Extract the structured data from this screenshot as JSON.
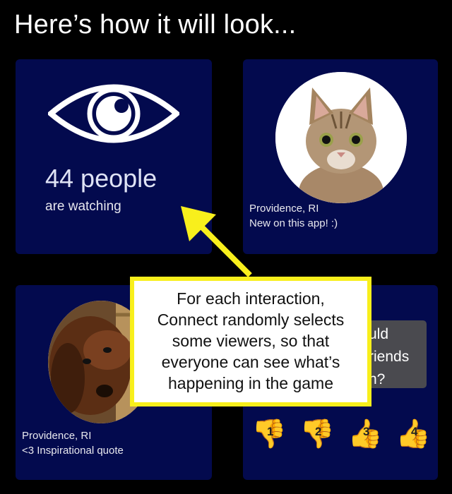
{
  "heading": "Here’s how it will look...",
  "viewers_card": {
    "count_text": "44 people",
    "sub_text": "are watching",
    "icon": "eye-icon"
  },
  "profile_cat": {
    "image": "cat-photo",
    "location": "Providence, RI",
    "bio": "New on this app! :)"
  },
  "profile_dog": {
    "image": "dog-photo",
    "location": "Providence, RI",
    "bio": "<3 Inspirational quote"
  },
  "question_card": {
    "question_fragments": [
      "uld",
      "riends",
      "n?"
    ],
    "ratings": [
      {
        "icon": "thumbs-down-icon",
        "label": "1"
      },
      {
        "icon": "thumbs-down-icon",
        "label": "2"
      },
      {
        "icon": "thumbs-up-icon",
        "label": "3"
      },
      {
        "icon": "thumbs-up-icon",
        "label": "4"
      }
    ]
  },
  "callout": {
    "text": "For each interaction, Connect randomly selects some viewers, so that everyone can see what’s happening in the game",
    "lines": [
      "For each interaction,",
      "Connect randomly selects",
      "some viewers, so that",
      "everyone can see what’s",
      "happening in the game"
    ]
  },
  "colors": {
    "card_bg": "#030a4e",
    "callout_border": "#f8ef1c",
    "arrow": "#f8ef1c"
  }
}
